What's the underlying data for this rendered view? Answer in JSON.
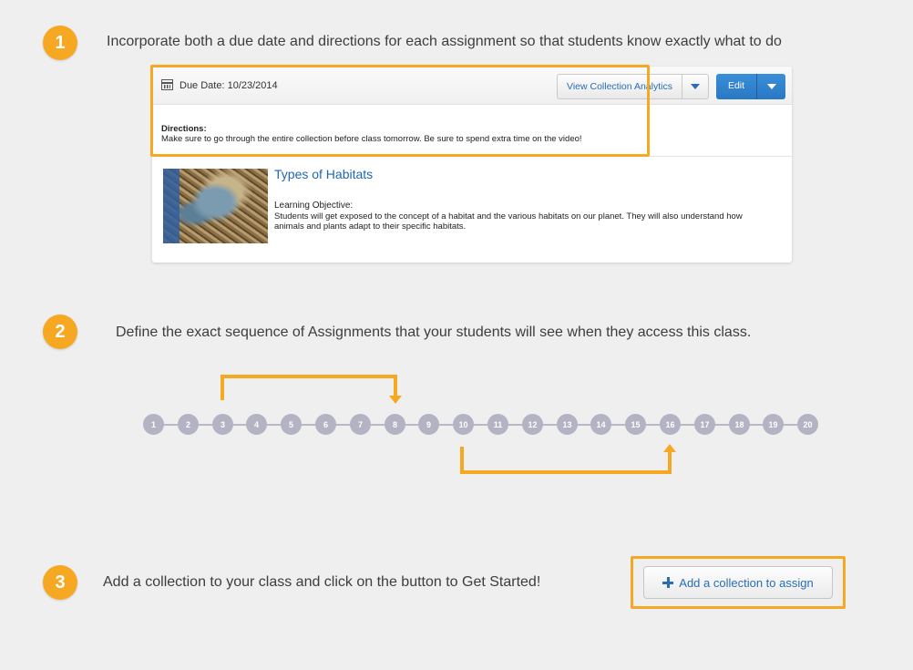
{
  "step1": {
    "number": "1",
    "text": "Incorporate both a due date and directions for each assignment so that  students know exactly what to do"
  },
  "card": {
    "due_date": "Due Date: 10/23/2014",
    "analytics_button": "View Collection Analytics",
    "edit_button": "Edit",
    "directions_label": "Directions:",
    "directions_text": "Make sure to go through the entire collection before class tomorrow. Be sure to spend extra time on the video!",
    "collection": {
      "title": "Types of Habitats",
      "objective_label": "Learning Objective:",
      "objective_text": "Students will get exposed to the concept of a habitat and the various habitats on our planet. They will also understand how animals and plants adapt to their specific habitats."
    }
  },
  "step2": {
    "number": "2",
    "text": "Define the exact sequence of Assignments that your students will see when they access this class.",
    "nodes": [
      "1",
      "2",
      "3",
      "4",
      "5",
      "6",
      "7",
      "8",
      "9",
      "10",
      "11",
      "12",
      "13",
      "14",
      "15",
      "16",
      "17",
      "18",
      "19",
      "20"
    ]
  },
  "step3": {
    "number": "3",
    "text": "Add a collection to your class and click on the button to Get Started!",
    "add_button": "Add a collection to assign"
  },
  "colors": {
    "accent": "#f7a823",
    "link": "#1f66b3",
    "primary_button": "#2a78c4",
    "node": "#b3b3c4"
  },
  "icons": [
    "calendar-icon",
    "chevron-down-icon",
    "plus-icon"
  ]
}
